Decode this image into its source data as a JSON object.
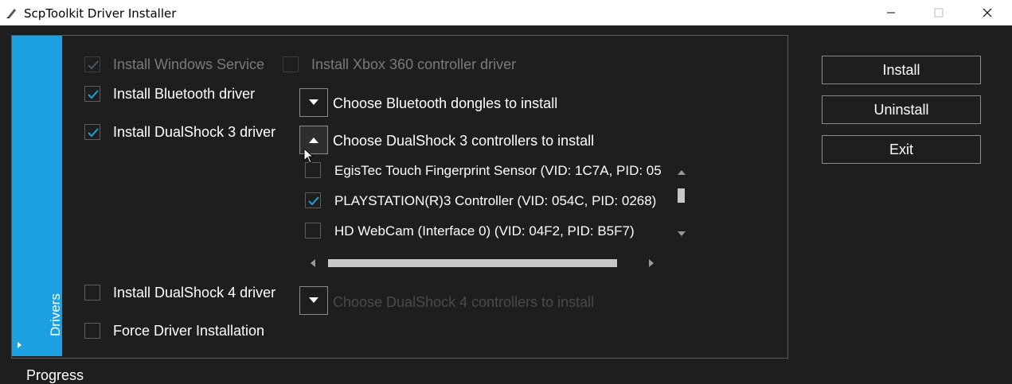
{
  "window": {
    "title": "ScpToolkit Driver Installer",
    "icons": [
      "pen-icon",
      "minimize-icon",
      "maximize-icon",
      "close-icon"
    ]
  },
  "sidebar": {
    "tab_label": "Drivers",
    "accent": "#1ba1e2"
  },
  "options": {
    "windows_service": {
      "label": "Install Windows Service",
      "checked": true,
      "enabled": false
    },
    "xbox_driver": {
      "label": "Install Xbox 360 controller driver",
      "checked": false,
      "enabled": false
    },
    "bluetooth_driver": {
      "label": "Install Bluetooth driver",
      "checked": true
    },
    "ds3_driver": {
      "label": "Install DualShock 3 driver",
      "checked": true
    },
    "ds4_driver": {
      "label": "Install DualShock 4 driver",
      "checked": false
    },
    "force_install": {
      "label": "Force Driver Installation",
      "checked": false
    }
  },
  "expanders": {
    "bluetooth": {
      "label": "Choose Bluetooth dongles to install",
      "expanded": false
    },
    "ds3": {
      "label": "Choose DualShock 3 controllers to install",
      "expanded": true
    },
    "ds4": {
      "label": "Choose DualShock 4 controllers to install",
      "expanded": false,
      "enabled": false
    }
  },
  "ds3_devices": [
    {
      "label": "EgisTec Touch Fingerprint Sensor (VID: 1C7A, PID: 05",
      "checked": false
    },
    {
      "label": "PLAYSTATION(R)3 Controller (VID: 054C, PID: 0268)",
      "checked": true
    },
    {
      "label": "HD WebCam (Interface 0) (VID: 04F2, PID: B5F7)",
      "checked": false
    }
  ],
  "actions": {
    "install": "Install",
    "uninstall": "Uninstall",
    "exit": "Exit"
  },
  "footer": {
    "progress_label": "Progress"
  },
  "colors": {
    "background": "#1e1e1e",
    "check": "#1ba1e2",
    "border": "#8a8a8a"
  }
}
